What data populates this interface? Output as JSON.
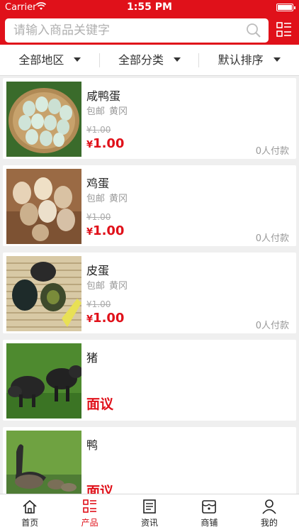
{
  "status": {
    "carrier": "Carrier",
    "time": "1:55 PM"
  },
  "search": {
    "placeholder": "请输入商品关键字"
  },
  "filters": [
    {
      "label": "全部地区"
    },
    {
      "label": "全部分类"
    },
    {
      "label": "默认排序"
    }
  ],
  "products": [
    {
      "name": "咸鸭蛋",
      "tag1": "包邮",
      "tag2": "黄冈",
      "old_price": "¥1.00",
      "price_symbol": "¥",
      "price": "1.00",
      "sold": "0人付款"
    },
    {
      "name": "鸡蛋",
      "tag1": "包邮",
      "tag2": "黄冈",
      "old_price": "¥1.00",
      "price_symbol": "¥",
      "price": "1.00",
      "sold": "0人付款"
    },
    {
      "name": "皮蛋",
      "tag1": "包邮",
      "tag2": "黄冈",
      "old_price": "¥1.00",
      "price_symbol": "¥",
      "price": "1.00",
      "sold": "0人付款"
    },
    {
      "name": "猪",
      "negotiable": "面议"
    },
    {
      "name": "鸭",
      "negotiable": "面议"
    }
  ],
  "tabs": [
    {
      "label": "首页",
      "icon": "home-icon"
    },
    {
      "label": "产品",
      "icon": "list-icon",
      "active": true
    },
    {
      "label": "资讯",
      "icon": "news-icon"
    },
    {
      "label": "商铺",
      "icon": "shop-icon"
    },
    {
      "label": "我的",
      "icon": "user-icon"
    }
  ],
  "colors": {
    "brand": "#e0111a",
    "background": "#efefef"
  }
}
